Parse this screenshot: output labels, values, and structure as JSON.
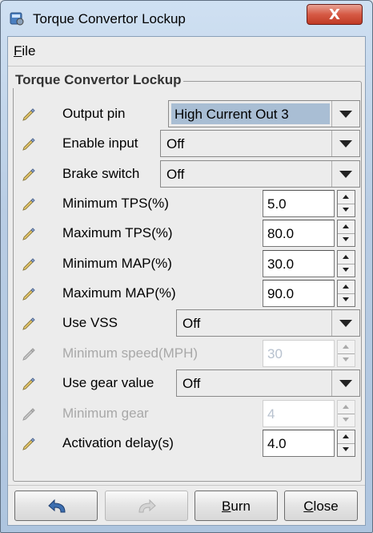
{
  "window": {
    "title": "Torque Convertor Lockup",
    "close_glyph": "X",
    "icon": "app-settings-icon"
  },
  "menu": {
    "file_mnemonic": "F",
    "file_rest": "ile"
  },
  "group": {
    "title": "Torque Convertor Lockup"
  },
  "fields": [
    {
      "label": "Output pin",
      "type": "combo",
      "value": "High Current Out 3",
      "enabled": true
    },
    {
      "label": "Enable input",
      "type": "combo",
      "value": "Off",
      "enabled": true
    },
    {
      "label": "Brake switch",
      "type": "combo",
      "value": "Off",
      "enabled": true
    },
    {
      "label": "Minimum TPS(%)",
      "type": "spinner",
      "value": "5.0",
      "enabled": true
    },
    {
      "label": "Maximum TPS(%)",
      "type": "spinner",
      "value": "80.0",
      "enabled": true
    },
    {
      "label": "Minimum MAP(%)",
      "type": "spinner",
      "value": "30.0",
      "enabled": true
    },
    {
      "label": "Maximum MAP(%)",
      "type": "spinner",
      "value": "90.0",
      "enabled": true
    },
    {
      "label": "Use VSS",
      "type": "combo",
      "value": "Off",
      "enabled": true
    },
    {
      "label": "Minimum speed(MPH)",
      "type": "spinner",
      "value": "30",
      "enabled": false
    },
    {
      "label": "Use gear value",
      "type": "combo",
      "value": "Off",
      "enabled": true
    },
    {
      "label": "Minimum gear",
      "type": "spinner",
      "value": "4",
      "enabled": false
    },
    {
      "label": "Activation delay(s)",
      "type": "spinner",
      "value": "4.0",
      "enabled": true
    }
  ],
  "buttons": {
    "undo_icon": "undo-icon",
    "redo_icon": "redo-icon",
    "burn_mnemonic": "B",
    "burn_rest": "urn",
    "close_mnemonic": "C",
    "close_rest": "lose"
  },
  "colors": {
    "highlight_combo": "#a9bed4",
    "title_bar": "#b9cde4",
    "close_button": "#d65a45"
  }
}
